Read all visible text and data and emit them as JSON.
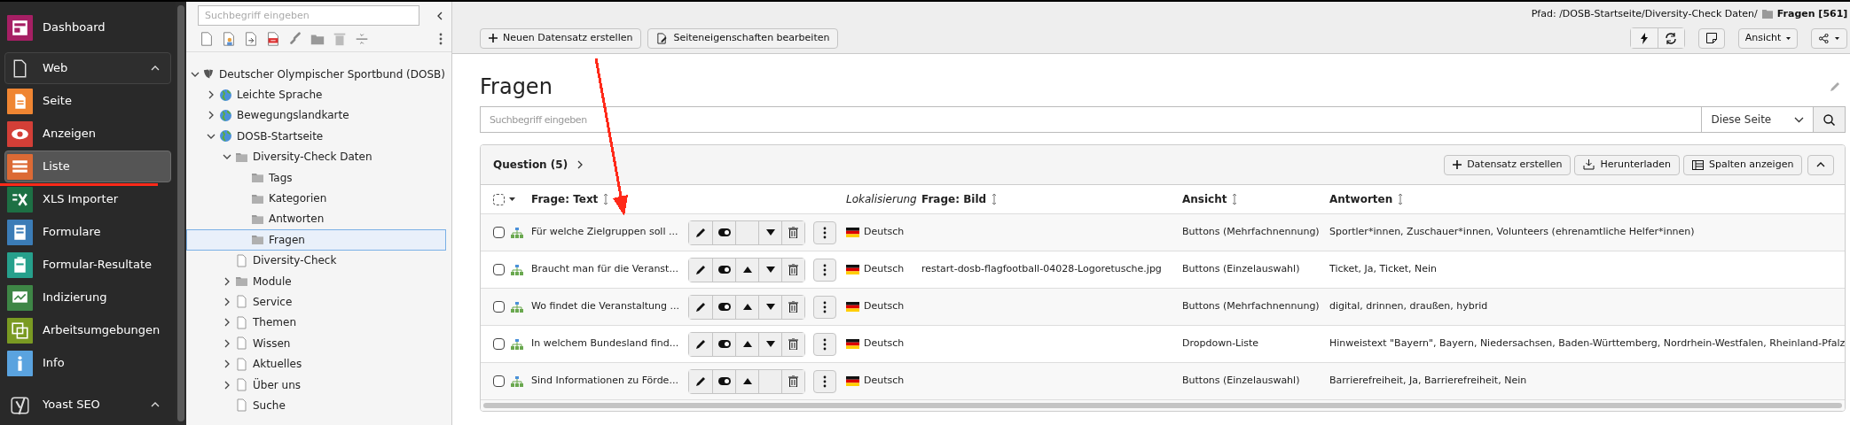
{
  "module_menu": {
    "top": {
      "kind": "dashboard",
      "label": "Dashboard",
      "color": "#a61f64",
      "selected": false
    },
    "groups": [
      {
        "kind": "web",
        "label": "Web",
        "expanded": true,
        "modules": [
          {
            "kind": "page",
            "label": "Seite",
            "color": "#ef8532",
            "selected": false
          },
          {
            "kind": "view",
            "label": "Anzeigen",
            "color": "#d33f37",
            "selected": false
          },
          {
            "kind": "list",
            "label": "Liste",
            "color": "#dc6a35",
            "selected": true
          },
          {
            "kind": "excel",
            "label": "XLS Importer",
            "color": "#1d7044",
            "selected": false
          },
          {
            "kind": "form",
            "label": "Formulare",
            "color": "#3b7cb7",
            "selected": false
          },
          {
            "kind": "results",
            "label": "Formular-Resultate",
            "color": "#26a08c",
            "selected": false
          },
          {
            "kind": "index",
            "label": "Indizierung",
            "color": "#3e8646",
            "selected": false
          },
          {
            "kind": "workspace",
            "label": "Arbeitsumgebungen",
            "color": "#7a9a22",
            "selected": false
          },
          {
            "kind": "info",
            "label": "Info",
            "color": "#5aa3df",
            "selected": false
          }
        ]
      },
      {
        "kind": "yoast",
        "label": "Yoast SEO",
        "expanded": true
      }
    ]
  },
  "page_tree": {
    "search": {
      "placeholder": "Suchbegriff eingeben"
    },
    "items": [
      {
        "label": "Deutscher Olympischer Sportbund (DOSB)",
        "kind": "root",
        "expandable": true,
        "expanded": true,
        "selected": false,
        "children": [
          {
            "label": "Leichte Sprache",
            "kind": "globe",
            "expandable": true,
            "expanded": false,
            "selected": false
          },
          {
            "label": "Bewegungslandkarte",
            "kind": "globe",
            "expandable": true,
            "expanded": false,
            "selected": false
          },
          {
            "label": "DOSB-Startseite",
            "kind": "globe",
            "expandable": true,
            "expanded": true,
            "selected": false,
            "children": [
              {
                "label": "Diversity-Check Daten",
                "kind": "folder",
                "expandable": true,
                "expanded": true,
                "selected": false,
                "children": [
                  {
                    "label": "Tags",
                    "kind": "folder",
                    "expandable": false,
                    "selected": false
                  },
                  {
                    "label": "Kategorien",
                    "kind": "folder",
                    "expandable": false,
                    "selected": false
                  },
                  {
                    "label": "Antworten",
                    "kind": "folder",
                    "expandable": false,
                    "selected": false
                  },
                  {
                    "label": "Fragen",
                    "kind": "folder",
                    "expandable": false,
                    "selected": true
                  }
                ]
              },
              {
                "label": "Diversity-Check",
                "kind": "page",
                "expandable": false,
                "selected": false
              },
              {
                "label": "Module",
                "kind": "folder",
                "expandable": true,
                "expanded": false,
                "selected": false
              },
              {
                "label": "Service",
                "kind": "page",
                "expandable": true,
                "expanded": false,
                "selected": false
              },
              {
                "label": "Themen",
                "kind": "page",
                "expandable": true,
                "expanded": false,
                "selected": false
              },
              {
                "label": "Wissen",
                "kind": "page",
                "expandable": true,
                "expanded": false,
                "selected": false
              },
              {
                "label": "Aktuelles",
                "kind": "page",
                "expandable": true,
                "expanded": false,
                "selected": false
              },
              {
                "label": "Über uns",
                "kind": "page",
                "expandable": true,
                "expanded": false,
                "selected": false
              },
              {
                "label": "Suche",
                "kind": "page",
                "expandable": false,
                "selected": false
              }
            ]
          }
        ]
      }
    ]
  },
  "docheader": {
    "path": {
      "prefix": "Pfad: /DOSB-Startseite/Diversity-Check Daten/",
      "page": "Fragen [561]"
    },
    "buttons": [
      "Neuen Datensatz erstellen",
      "Seiteneigenschaften bearbeiten"
    ],
    "view_menu": "Ansicht"
  },
  "content": {
    "title": "Fragen",
    "search": {
      "placeholder": "Suchbegriff eingeben",
      "scope": "Diese Seite"
    },
    "table": {
      "title": "Question (5)",
      "all_selected": false,
      "buttons": [
        "Datensatz erstellen",
        "Herunterladen",
        "Spalten anzeigen"
      ],
      "columns": [
        {
          "label": "Frage: Text",
          "sortable": true
        },
        {
          "label": "Lokalisierung",
          "sortable": false
        },
        {
          "label": "Frage: Bild",
          "sortable": true
        },
        {
          "label": "Ansicht",
          "sortable": true
        },
        {
          "label": "Antworten",
          "sortable": true
        }
      ],
      "rows": [
        {
          "checked": false,
          "title": "Für welche Zielgruppen soll ...",
          "move_up": false,
          "move_down": true,
          "language": "Deutsch",
          "view": "Buttons (Mehrfachnennung)",
          "answers": "Sportler*innen, Zuschauer*innen, Volunteers (ehrenamtliche Helfer*innen)"
        },
        {
          "checked": false,
          "title": "Braucht man für die Veranst...",
          "move_up": true,
          "move_down": true,
          "language": "Deutsch",
          "image": "restart-dosb-flagfootball-04028-Logoretusche.jpg",
          "view": "Buttons (Einzelauswahl)",
          "answers": "Ticket, Ja, Ticket, Nein"
        },
        {
          "checked": false,
          "title": "Wo findet die Veranstaltung ...",
          "move_up": true,
          "move_down": true,
          "language": "Deutsch",
          "view": "Buttons (Mehrfachnennung)",
          "answers": "digital, drinnen, draußen, hybrid"
        },
        {
          "checked": false,
          "title": "In welchem Bundesland find...",
          "move_up": true,
          "move_down": true,
          "language": "Deutsch",
          "view": "Dropdown-Liste",
          "answers": "Hinweistext \"Bayern\", Bayern, Niedersachsen, Baden-Württemberg, Nordrhein-Westfalen, Rheinland-Pfalz"
        },
        {
          "checked": false,
          "title": "Sind Informationen zu Förde...",
          "move_up": true,
          "move_down": false,
          "language": "Deutsch",
          "view": "Buttons (Einzelauswahl)",
          "answers": "Barrierefreiheit, Ja, Barrierefreiheit, Nein"
        }
      ]
    }
  },
  "annotations": {
    "arrow": {
      "color": "#ff2a1a"
    },
    "underline": {
      "color": "#ff2a1a"
    }
  }
}
